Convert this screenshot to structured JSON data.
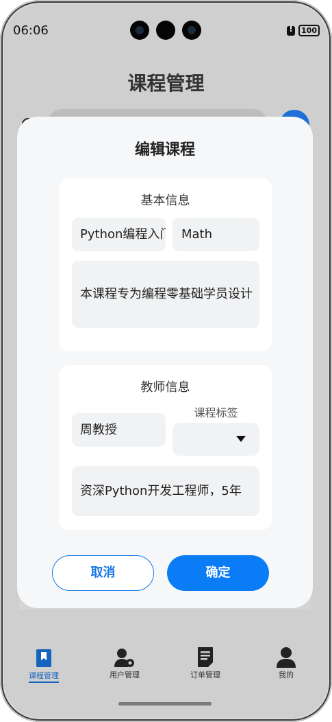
{
  "status_bar": {
    "time": "06:06",
    "battery": "100"
  },
  "page": {
    "title": "课程管理"
  },
  "dialog": {
    "title": "编辑课程",
    "basic_section": {
      "title": "基本信息",
      "course_name": "Python编程入门",
      "category": "Math",
      "description": "本课程专为编程零基础学员设计"
    },
    "teacher_section": {
      "title": "教师信息",
      "teacher_name": "周教授",
      "tag_label": "课程标签",
      "tag_value": "",
      "bio": "资深Python开发工程师，5年"
    },
    "cancel_label": "取消",
    "confirm_label": "确定"
  },
  "bottom_nav": {
    "items": [
      {
        "label": "课程管理",
        "icon": "book-icon",
        "active": true
      },
      {
        "label": "用户管理",
        "icon": "user-settings-icon",
        "active": false
      },
      {
        "label": "订单管理",
        "icon": "order-document-icon",
        "active": false
      },
      {
        "label": "我的",
        "icon": "person-icon",
        "active": false
      }
    ]
  },
  "colors": {
    "accent": "#0a7cf5",
    "active_nav": "#1565c0",
    "overlay": "#cfcfcf"
  }
}
